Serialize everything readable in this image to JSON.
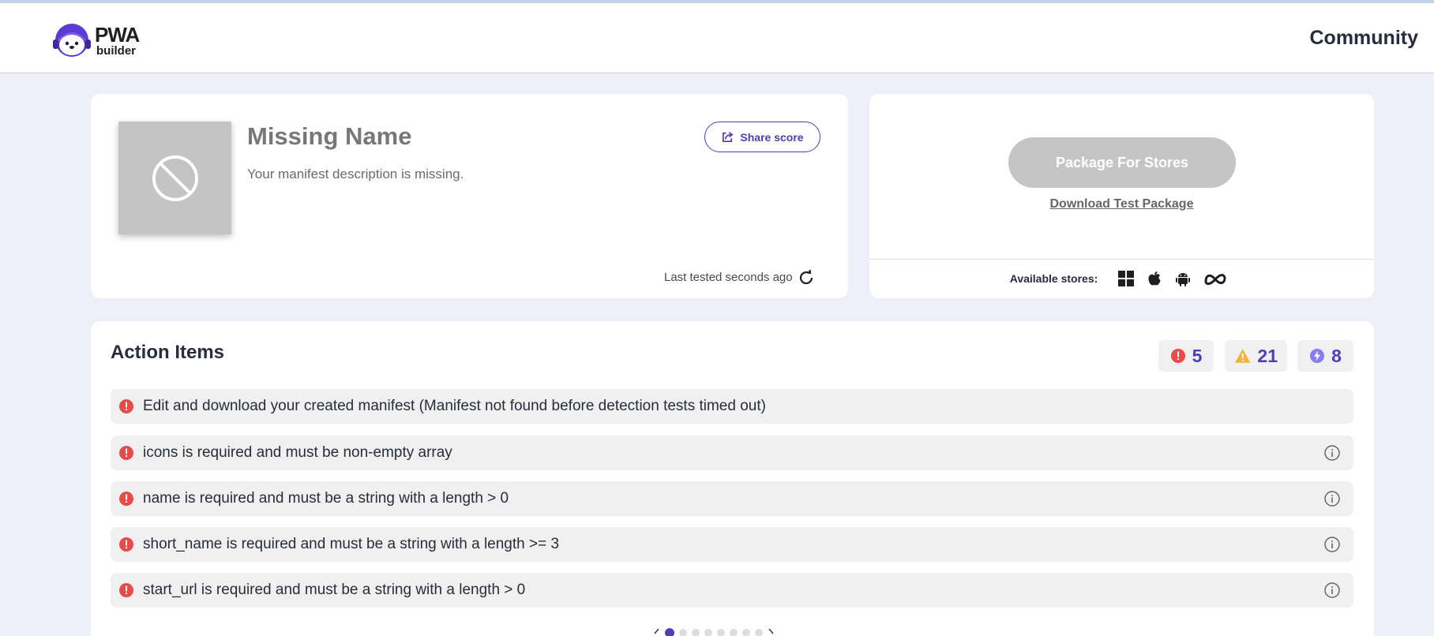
{
  "header": {
    "logo_line1": "PWA",
    "logo_line2": "builder",
    "community_label": "Community"
  },
  "app": {
    "name": "Missing Name",
    "description": "Your manifest description is missing.",
    "share_label": "Share score",
    "last_tested": "Last tested seconds ago"
  },
  "package": {
    "button_label": "Package For Stores",
    "download_label": "Download Test Package",
    "stores_label": "Available stores:",
    "stores": [
      "windows-icon",
      "apple-icon",
      "android-icon",
      "meta-icon"
    ]
  },
  "action_items": {
    "title": "Action Items",
    "counts": {
      "errors": "5",
      "warnings": "21",
      "suggestions": "8"
    },
    "items": [
      {
        "text": "Edit and download your created manifest (Manifest not found before detection tests timed out)",
        "has_info": false
      },
      {
        "text": "icons is required and must be non-empty array",
        "has_info": true
      },
      {
        "text": "name is required and must be a string with a length > 0",
        "has_info": true
      },
      {
        "text": "short_name is required and must be a string with a length >= 3",
        "has_info": true
      },
      {
        "text": "start_url is required and must be a string with a length > 0",
        "has_info": true
      }
    ]
  },
  "colors": {
    "accent": "#4f3fb6",
    "error": "#e74c4c",
    "warning": "#f0b43c",
    "suggestion": "#8a7cf0"
  }
}
